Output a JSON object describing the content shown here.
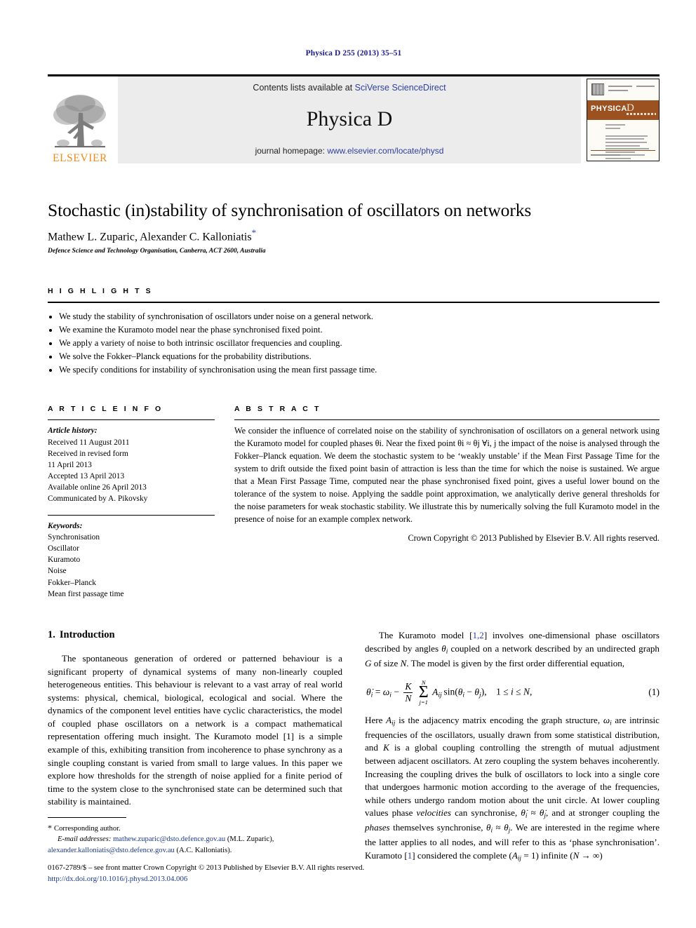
{
  "running_head": "Physica D 255 (2013) 35–51",
  "masthead": {
    "publisher_logo_label": "ELSEVIER",
    "contents_prefix": "Contents lists available at ",
    "contents_link": "SciVerse ScienceDirect",
    "journal_title": "Physica D",
    "homepage_prefix": "journal homepage: ",
    "homepage_link": "www.elsevier.com/locate/physd",
    "cover_journal_name": "PHYSICA",
    "cover_journal_letter": "D"
  },
  "title": "Stochastic (in)stability of synchronisation of oscillators on networks",
  "authors": "Mathew L. Zuparic, Alexander C. Kalloniatis",
  "author_star": "*",
  "affiliation": "Defence Science and Technology Organisation, Canberra, ACT 2600, Australia",
  "highlights": {
    "heading": "H I G H L I G H T S",
    "items": [
      "We study the stability of synchronisation of oscillators under noise on a general network.",
      "We examine the Kuramoto model near the phase synchronised fixed point.",
      "We apply a variety of noise to both intrinsic oscillator frequencies and coupling.",
      "We solve the Fokker–Planck equations for the probability distributions.",
      "We specify conditions for instability of synchronisation using the mean first passage time."
    ]
  },
  "article_info": {
    "heading": "A R T I C L E    I N F O",
    "history_label": "Article history:",
    "history": [
      "Received 11 August 2011",
      "Received in revised form",
      "11 April 2013",
      "Accepted 13 April 2013",
      "Available online 26 April 2013",
      "Communicated by A. Pikovsky"
    ],
    "keywords_label": "Keywords:",
    "keywords": [
      "Synchronisation",
      "Oscillator",
      "Kuramoto",
      "Noise",
      "Fokker–Planck",
      "Mean first passage time"
    ]
  },
  "abstract": {
    "heading": "A B S T R A C T",
    "text": "We consider the influence of correlated noise on the stability of synchronisation of oscillators on a general network using the Kuramoto model for coupled phases θi. Near the fixed point θi ≈ θj ∀i, j the impact of the noise is analysed through the Fokker–Planck equation. We deem the stochastic system to be ‘weakly unstable’ if the Mean First Passage Time for the system to drift outside the fixed point basin of attraction is less than the time for which the noise is sustained. We argue that a Mean First Passage Time, computed near the phase synchronised fixed point, gives a useful lower bound on the tolerance of the system to noise. Applying the saddle point approximation, we analytically derive general thresholds for the noise parameters for weak stochastic stability. We illustrate this by numerically solving the full Kuramoto model in the presence of noise for an example complex network.",
    "copyright": "Crown Copyright © 2013 Published by Elsevier B.V. All rights reserved."
  },
  "body": {
    "section_number": "1.",
    "section_title": "Introduction",
    "left_paragraph_1": "The spontaneous generation of ordered or patterned behaviour is a significant property of dynamical systems of many non-linearly coupled heterogeneous entities. This behaviour is relevant to a vast array of real world systems: physical, chemical, biological, ecological and social. Where the dynamics of the component level entities have cyclic characteristics, the model of coupled phase oscillators on a network is a compact mathematical representation offering much insight. The Kuramoto model [1] is a simple example of this, exhibiting transition from incoherence to phase synchrony as a single coupling constant is varied from small to large values. In this paper we explore how thresholds for the strength of noise applied for a finite period of time to the system close to the synchronised state can be determined such that stability is maintained.",
    "right_paragraph_1": "The Kuramoto model [1,2] involves one-dimensional phase oscillators described by angles θi coupled on a network described by an undirected graph G of size N. The model is given by the first order differential equation,",
    "equation_number": "(1)",
    "equation_text": "θ̇i = ωi − (K/N) Σ(j=1..N) Aij sin(θi − θj),   1 ≤ i ≤ N,",
    "right_paragraph_2": "Here Aij is the adjacency matrix encoding the graph structure, ωi are intrinsic frequencies of the oscillators, usually drawn from some statistical distribution, and K is a global coupling controlling the strength of mutual adjustment between adjacent oscillators. At zero coupling the system behaves incoherently. Increasing the coupling drives the bulk of oscillators to lock into a single core that undergoes harmonic motion according to the average of the frequencies, while others undergo random motion about the unit circle. At lower coupling values phase velocities can synchronise, θ̇i ≈ θ̇j, and at stronger coupling the phases themselves synchronise, θi ≈ θj. We are interested in the regime where the latter applies to all nodes, and will refer to this as ‘phase synchronisation’. Kuramoto [1] considered the complete (Aij = 1) infinite (N → ∞)"
  },
  "footnote": {
    "corresponding": "Corresponding author.",
    "email_label": "E-mail addresses:",
    "email_1": "mathew.zuparic@dsto.defence.gov.au",
    "email_1_owner": "(M.L. Zuparic),",
    "email_2": "alexander.kalloniatis@dsto.defence.gov.au",
    "email_2_owner": "(A.C. Kalloniatis)."
  },
  "page_footer": {
    "issn_line": "0167-2789/$ – see front matter Crown Copyright © 2013 Published by Elsevier B.V. All rights reserved.",
    "doi": "http://dx.doi.org/10.1016/j.physd.2013.04.006"
  },
  "colors": {
    "link_blue": "#2b3f9e",
    "elsevier_orange": "#f08a1b",
    "cover_brown": "#9c5121",
    "band_grey": "#ececec"
  }
}
